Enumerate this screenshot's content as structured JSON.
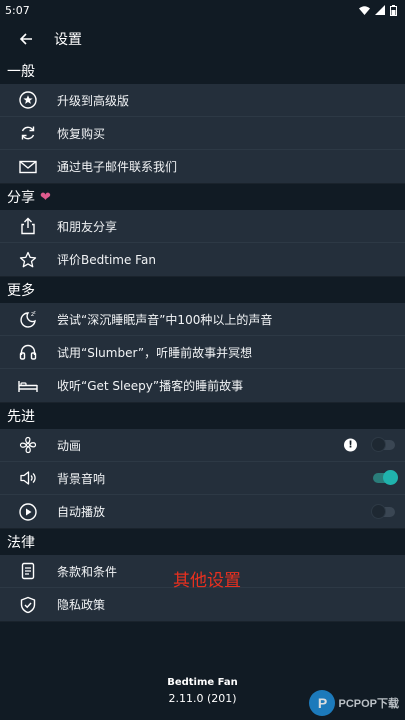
{
  "status_bar": {
    "time": "5:07"
  },
  "app_bar": {
    "title": "设置"
  },
  "sections": {
    "general": {
      "header": "一般",
      "items": [
        "升级到高级版",
        "恢复购买",
        "通过电子邮件联系我们"
      ]
    },
    "share": {
      "header": "分享",
      "items": [
        "和朋友分享",
        "评价Bedtime Fan"
      ]
    },
    "more": {
      "header": "更多",
      "items": [
        "尝试“深沉睡眠声音”中100种以上的声音",
        "试用“Slumber”，听睡前故事并冥想",
        "收听“Get Sleepy”播客的睡前故事"
      ]
    },
    "advanced": {
      "header": "先进",
      "items": [
        "动画",
        "背景音响",
        "自动播放"
      ],
      "toggles": {
        "animation": false,
        "background_sound": true,
        "autoplay": false
      }
    },
    "legal": {
      "header": "法律",
      "items": [
        "条款和条件",
        "隐私政策"
      ]
    }
  },
  "overlay_caption": "其他设置",
  "footer": {
    "app_name": "Bedtime Fan",
    "version": "2.11.0 (201)"
  },
  "watermark": {
    "logo": "P",
    "text": "PCPOP下载"
  },
  "colors": {
    "accent": "#20b3ad",
    "heart": "#e05b8e",
    "caption": "#e8301f"
  }
}
